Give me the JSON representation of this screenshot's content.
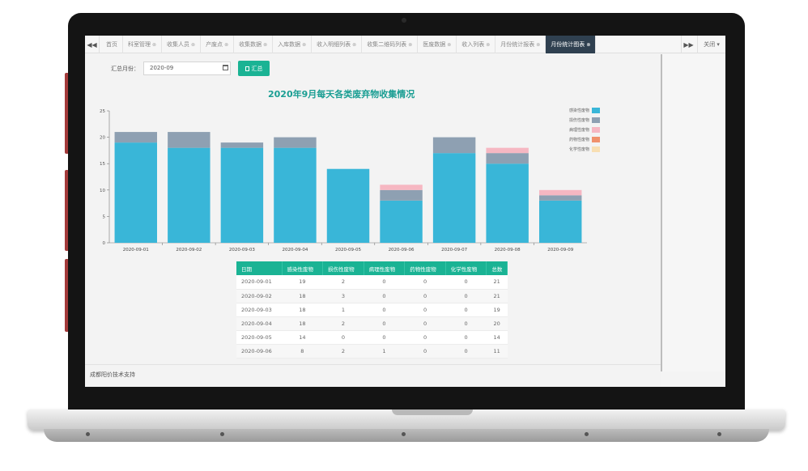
{
  "tabs": {
    "prev_label": "◀◀",
    "next_label": "▶▶",
    "action_label": "关闭 ▾",
    "items": [
      {
        "label": "首页",
        "closable": false,
        "active": false
      },
      {
        "label": "科室管理",
        "closable": true,
        "active": false
      },
      {
        "label": "收集人员",
        "closable": true,
        "active": false
      },
      {
        "label": "产废点",
        "closable": true,
        "active": false
      },
      {
        "label": "收集数据",
        "closable": true,
        "active": false
      },
      {
        "label": "入库数据",
        "closable": true,
        "active": false
      },
      {
        "label": "收入明细列表",
        "closable": true,
        "active": false
      },
      {
        "label": "收集二维码列表",
        "closable": true,
        "active": false
      },
      {
        "label": "医废数据",
        "closable": true,
        "active": false
      },
      {
        "label": "收入列表",
        "closable": true,
        "active": false
      },
      {
        "label": "月份统计报表",
        "closable": true,
        "active": false
      },
      {
        "label": "月份统计图表",
        "closable": true,
        "active": true
      }
    ]
  },
  "filter": {
    "label": "汇总月份：",
    "month_value": "2020-09",
    "button_label": "汇总"
  },
  "chart_title": "2020年9月每天各类废弃物收集情况",
  "chart_data": {
    "type": "bar",
    "stacked": true,
    "categories": [
      "2020-09-01",
      "2020-09-02",
      "2020-09-03",
      "2020-09-04",
      "2020-09-05",
      "2020-09-06",
      "2020-09-07",
      "2020-09-08",
      "2020-09-09"
    ],
    "series": [
      {
        "name": "感染性废物",
        "color": "#39b6d8",
        "values": [
          19,
          18,
          18,
          18,
          14,
          8,
          17,
          15,
          8
        ]
      },
      {
        "name": "损伤性废物",
        "color": "#8ea0b2",
        "values": [
          2,
          3,
          1,
          2,
          0,
          2,
          3,
          2,
          1
        ]
      },
      {
        "name": "病理性废物",
        "color": "#f6b7c2",
        "values": [
          0,
          0,
          0,
          0,
          0,
          1,
          0,
          1,
          1
        ]
      },
      {
        "name": "药物性废物",
        "color": "#f0916c",
        "values": [
          0,
          0,
          0,
          0,
          0,
          0,
          0,
          0,
          0
        ]
      },
      {
        "name": "化学性废物",
        "color": "#f8dfb3",
        "values": [
          0,
          0,
          0,
          0,
          0,
          0,
          0,
          0,
          0
        ]
      }
    ],
    "ylim": [
      0,
      25
    ],
    "yticks": [
      0,
      5,
      10,
      15,
      20,
      25
    ],
    "legend_position": "top-right",
    "grid": false
  },
  "table": {
    "headers": [
      "日期",
      "感染性废物",
      "损伤性废物",
      "病理性废物",
      "药物性废物",
      "化学性废物",
      "总数"
    ],
    "rows": [
      [
        "2020-09-01",
        "19",
        "2",
        "0",
        "0",
        "0",
        "21"
      ],
      [
        "2020-09-02",
        "18",
        "3",
        "0",
        "0",
        "0",
        "21"
      ],
      [
        "2020-09-03",
        "18",
        "1",
        "0",
        "0",
        "0",
        "19"
      ],
      [
        "2020-09-04",
        "18",
        "2",
        "0",
        "0",
        "0",
        "20"
      ],
      [
        "2020-09-05",
        "14",
        "0",
        "0",
        "0",
        "0",
        "14"
      ],
      [
        "2020-09-06",
        "8",
        "2",
        "1",
        "0",
        "0",
        "11"
      ]
    ]
  },
  "footer": {
    "text": "成都阳价技术支持"
  }
}
